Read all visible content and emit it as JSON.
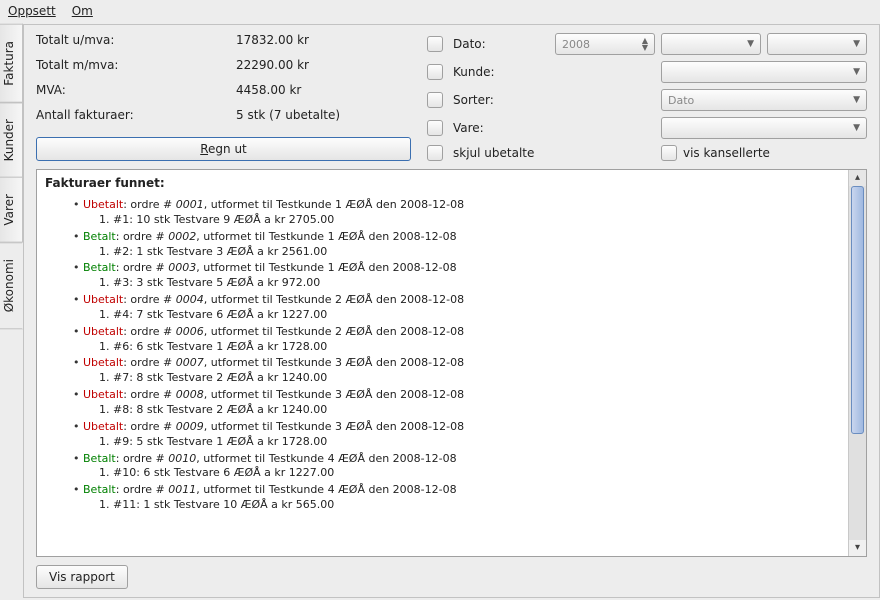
{
  "menu": {
    "setup": "Oppsett",
    "about": "Om"
  },
  "tabs": {
    "invoice": "Faktura",
    "customers": "Kunder",
    "products": "Varer",
    "economy": "Økonomi"
  },
  "totals": {
    "exvat_label": "Totalt u/mva:",
    "exvat_value": "17832.00 kr",
    "incvat_label": "Totalt m/mva:",
    "incvat_value": "22290.00 kr",
    "vat_label": "MVA:",
    "vat_value": "4458.00 kr",
    "count_label": "Antall fakturaer:",
    "count_value": "5 stk (7 ubetalte)"
  },
  "filters": {
    "date_label": "Dato:",
    "date_value": "2008",
    "customer_label": "Kunde:",
    "sort_label": "Sorter:",
    "sort_value": "Dato",
    "product_label": "Vare:",
    "hide_unpaid": "skjul ubetalte",
    "show_cancelled": "vis kansellerte"
  },
  "buttons": {
    "calc": "Regn ut",
    "report": "Vis rapport"
  },
  "results": {
    "title": "Fakturaer funnet:",
    "status_labels": {
      "unpaid": "Ubetalt",
      "paid": "Betalt"
    },
    "items": [
      {
        "status": "unpaid",
        "order": "0001",
        "line": ", utformet til Testkunde 1 ÆØÅ den 2008-12-08",
        "sub": "1. #1: 10 stk Testvare 9 ÆØÅ a kr 2705.00"
      },
      {
        "status": "paid",
        "order": "0002",
        "line": ", utformet til Testkunde 1 ÆØÅ den 2008-12-08",
        "sub": "1. #2: 1 stk Testvare 3 ÆØÅ a kr 2561.00"
      },
      {
        "status": "paid",
        "order": "0003",
        "line": ", utformet til Testkunde 1 ÆØÅ den 2008-12-08",
        "sub": "1. #3: 3 stk Testvare 5 ÆØÅ a kr 972.00"
      },
      {
        "status": "unpaid",
        "order": "0004",
        "line": ", utformet til Testkunde 2 ÆØÅ den 2008-12-08",
        "sub": "1. #4: 7 stk Testvare 6 ÆØÅ a kr 1227.00"
      },
      {
        "status": "unpaid",
        "order": "0006",
        "line": ", utformet til Testkunde 2 ÆØÅ den 2008-12-08",
        "sub": "1. #6: 6 stk Testvare 1 ÆØÅ a kr 1728.00"
      },
      {
        "status": "unpaid",
        "order": "0007",
        "line": ", utformet til Testkunde 3 ÆØÅ den 2008-12-08",
        "sub": "1. #7: 8 stk Testvare 2 ÆØÅ a kr 1240.00"
      },
      {
        "status": "unpaid",
        "order": "0008",
        "line": ", utformet til Testkunde 3 ÆØÅ den 2008-12-08",
        "sub": "1. #8: 8 stk Testvare 2 ÆØÅ a kr 1240.00"
      },
      {
        "status": "unpaid",
        "order": "0009",
        "line": ", utformet til Testkunde 3 ÆØÅ den 2008-12-08",
        "sub": "1. #9: 5 stk Testvare 1 ÆØÅ a kr 1728.00"
      },
      {
        "status": "paid",
        "order": "0010",
        "line": ", utformet til Testkunde 4 ÆØÅ den 2008-12-08",
        "sub": "1. #10: 6 stk Testvare 6 ÆØÅ a kr 1227.00"
      },
      {
        "status": "paid",
        "order": "0011",
        "line": ", utformet til Testkunde 4 ÆØÅ den 2008-12-08",
        "sub": "1. #11: 1 stk Testvare 10 ÆØÅ a kr 565.00"
      }
    ],
    "order_prefix": ": ordre # "
  }
}
